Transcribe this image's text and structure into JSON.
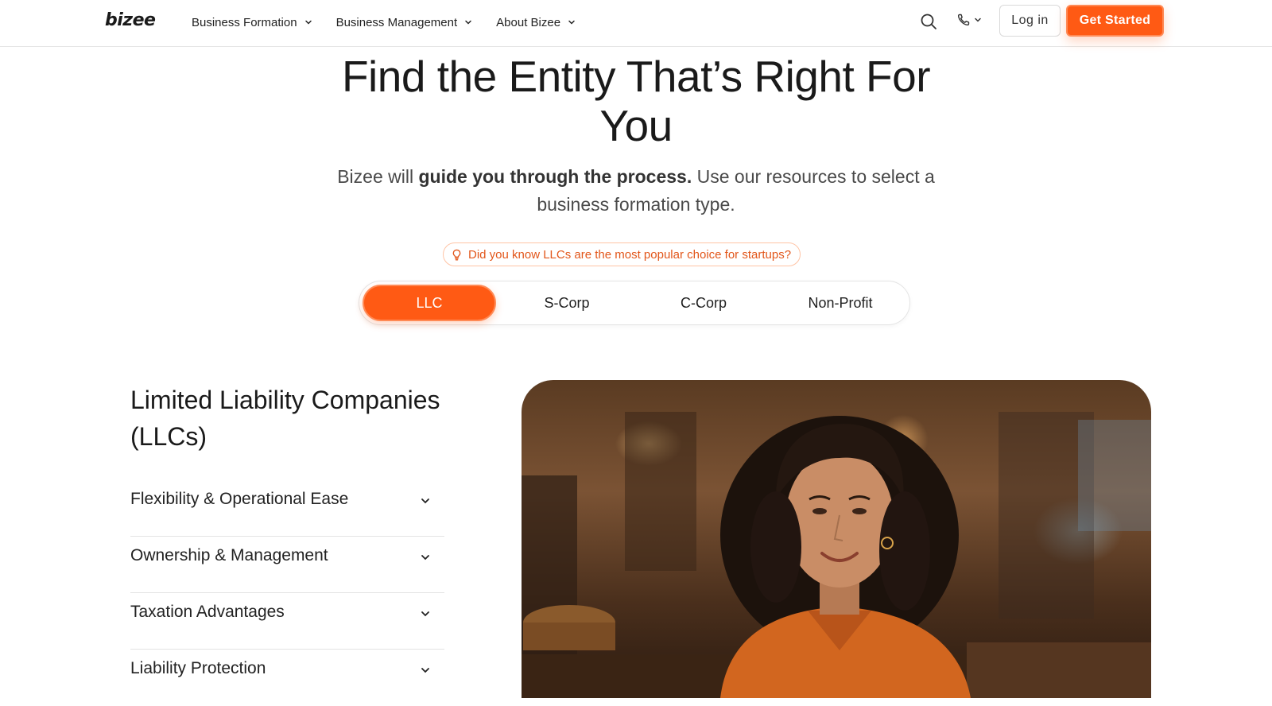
{
  "header": {
    "logo": "bizee",
    "nav": [
      {
        "label": "Business Formation"
      },
      {
        "label": "Business Management"
      },
      {
        "label": "About Bizee"
      }
    ],
    "login_label": "Log in",
    "cta_label": "Get Started"
  },
  "hero": {
    "title": "Find the Entity That’s Right For You",
    "subtitle_pre": "Bizee will ",
    "subtitle_bold": "guide you through the process.",
    "subtitle_post": " Use our resources to select a business formation type.",
    "tip": "Did you know LLCs are the most popular choice for startups?"
  },
  "tabs": [
    {
      "label": "LLC",
      "active": true
    },
    {
      "label": "S-Corp",
      "active": false
    },
    {
      "label": "C-Corp",
      "active": false
    },
    {
      "label": "Non-Profit",
      "active": false
    }
  ],
  "section": {
    "title": "Limited Liability Companies (LLCs)",
    "accordion": [
      {
        "label": "Flexibility & Operational Ease"
      },
      {
        "label": "Ownership & Management"
      },
      {
        "label": "Taxation Advantages"
      },
      {
        "label": "Liability Protection"
      }
    ]
  },
  "colors": {
    "accent": "#ff5a14",
    "tip_text": "#e2561a"
  }
}
